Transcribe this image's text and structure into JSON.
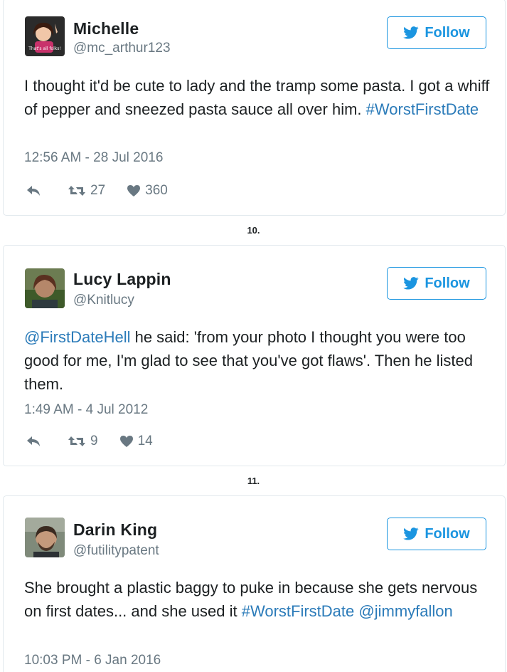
{
  "follow_label": "Follow",
  "colors": {
    "link": "#2b7bb9",
    "follow": "#1b95e0",
    "meta": "#697882"
  },
  "tweets": [
    {
      "name": "Michelle",
      "handle": "@mc_arthur123",
      "avatar_caption": "That's all folks!",
      "text_plain": "I thought it'd be cute to lady and the tramp some pasta. I got a whiff of pepper and sneezed pasta sauce all over him.",
      "hashtag": "#WorstFirstDate",
      "timestamp": "12:56 AM - 28 Jul 2016",
      "retweets": "27",
      "likes": "360"
    },
    {
      "name": "Lucy Lappin",
      "handle": "@Knitlucy",
      "mention": "@FirstDateHell",
      "text_plain": "he said: 'from your photo I thought you were too good for me, I'm glad to see that you've got flaws'. Then he listed them.",
      "timestamp": "1:49 AM - 4 Jul 2012",
      "retweets": "9",
      "likes": "14"
    },
    {
      "name": "Darin King",
      "handle": "@futilitypatent",
      "text_plain": "She brought a plastic baggy to puke in because she gets nervous on first dates... and she used it",
      "hashtag": "#WorstFirstDate",
      "mention": "@jimmyfallon",
      "timestamp": "10:03 PM - 6 Jan 2016"
    }
  ],
  "list_numbers": [
    "10.",
    "11."
  ]
}
